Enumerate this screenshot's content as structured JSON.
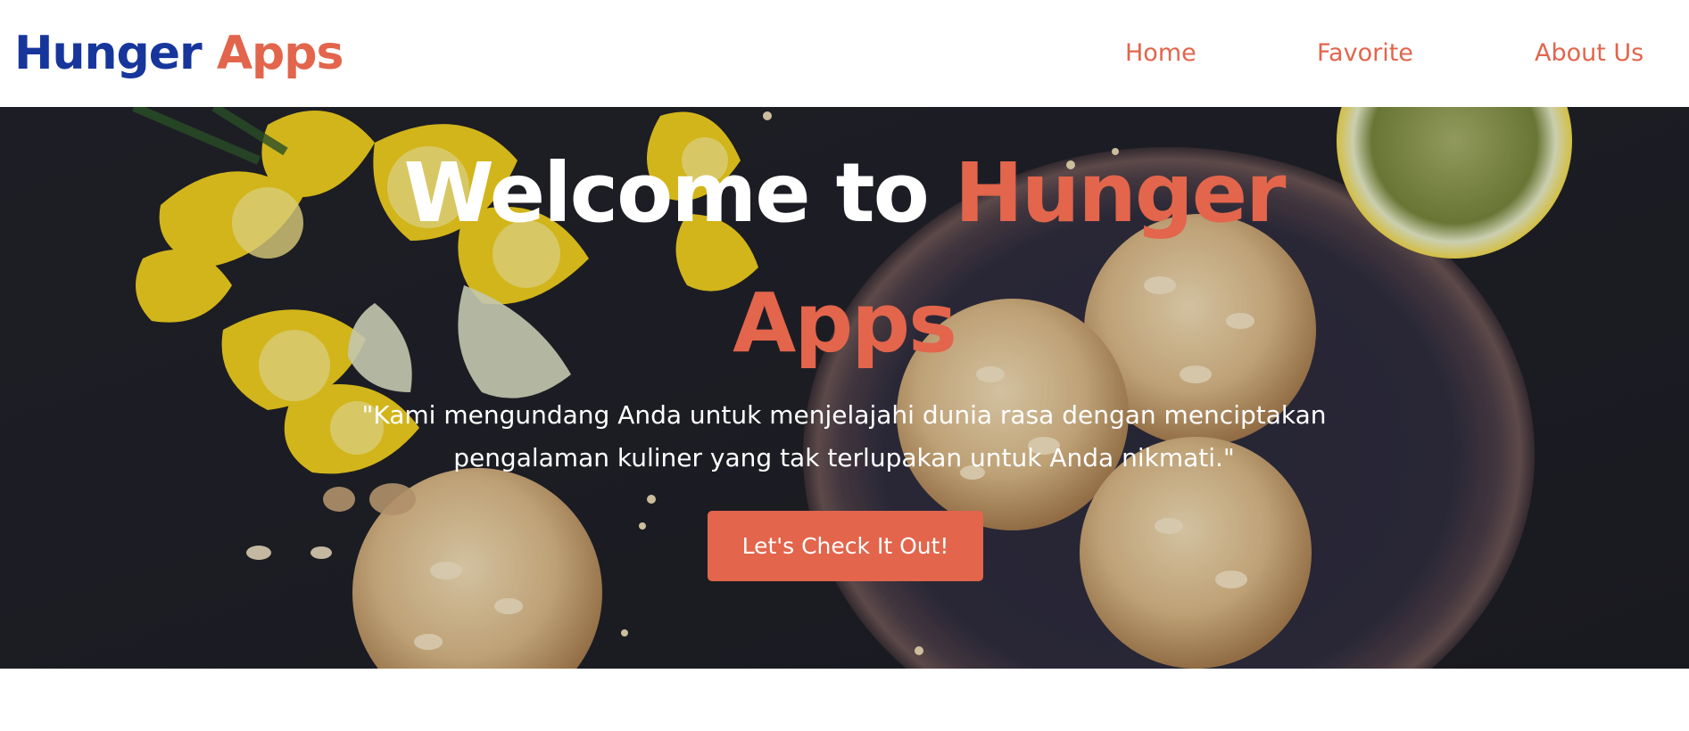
{
  "header": {
    "logo_part1": "Hunger",
    "logo_part2": "Apps",
    "nav": {
      "home": "Home",
      "favorite": "Favorite",
      "about": "About Us"
    }
  },
  "hero": {
    "title_white": "Welcome to",
    "title_accent": "Hunger Apps",
    "quote": "\"Kami mengundang Anda untuk menjelajahi dunia rasa dengan menciptakan pengalaman kuliner yang tak terlupakan untuk Anda nikmati.\"",
    "cta_label": "Let's Check It Out!"
  },
  "colors": {
    "brand_blue": "#17369c",
    "accent": "#e2654c",
    "hero_background": "#25262c"
  },
  "icons": [
    "hero-background-photo"
  ]
}
